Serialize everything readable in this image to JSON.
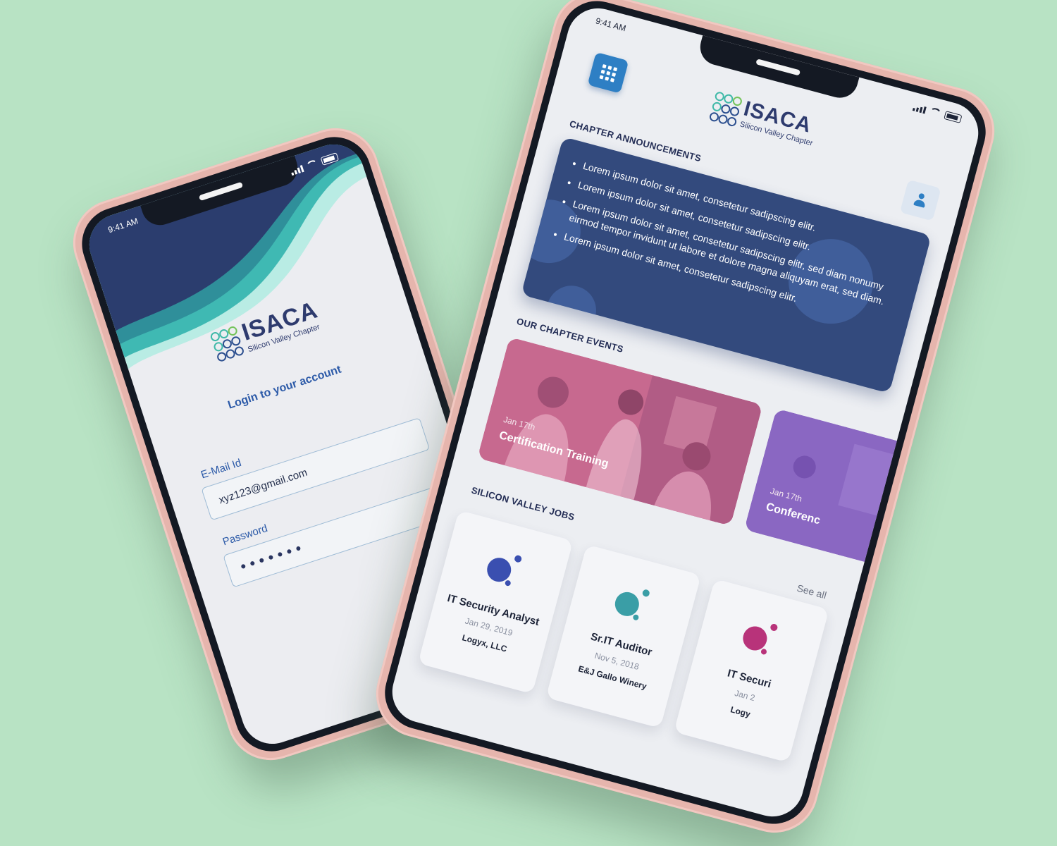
{
  "colors": {
    "background": "#b8e3c4",
    "phone_case": "#e6b5ad",
    "navy": "#2e3b6e",
    "accent_blue": "#2e7fc4",
    "teal": "#3fb9a8"
  },
  "login_screen": {
    "status": {
      "time": "9:41 AM"
    },
    "logo": {
      "word": "ISACA",
      "subtitle": "Silicon Valley Chapter"
    },
    "title": "Login to your account",
    "email": {
      "label": "E-Mail Id",
      "value": "xyz123@gmail.com"
    },
    "password": {
      "label": "Password",
      "value": "•••••••"
    }
  },
  "home_screen": {
    "status": {
      "time": "9:41 AM"
    },
    "menu_icon": "grid-menu-icon",
    "profile_icon": "user-icon",
    "logo": {
      "word": "ISACA",
      "subtitle": "Silicon Valley Chapter"
    },
    "announcements": {
      "title": "CHAPTER ANNOUNCEMENTS",
      "items": [
        "Lorem ipsum dolor sit amet, consetetur sadipscing elitr.",
        "Lorem ipsum dolor sit amet, consetetur sadipscing elitr.",
        "Lorem ipsum dolor sit amet, consetetur sadipscing elitr, sed diam nonumy eirmod tempor invidunt ut labore et dolore magna aliquyam erat, sed diam.",
        "Lorem ipsum dolor sit amet, consetetur sadipscing elitr."
      ]
    },
    "events": {
      "title": "OUR CHAPTER EVENTS",
      "items": [
        {
          "date": "Jan 17th",
          "name": "Certification Training",
          "tint": "#c7698f"
        },
        {
          "date": "Jan 17th",
          "name": "Conferenc",
          "tint": "#8a67c2"
        }
      ]
    },
    "jobs": {
      "title": "SILICON VALLEY JOBS",
      "see_all": "See all",
      "items": [
        {
          "title": "IT Security Analyst",
          "date": "Jan 29, 2019",
          "company": "Logyx, LLC",
          "color": "#3a4fb0"
        },
        {
          "title": "Sr.IT Auditor",
          "date": "Nov 5, 2018",
          "company": "E&J Gallo Winery",
          "color": "#3a9ea6"
        },
        {
          "title": "IT Securi",
          "date": "Jan 2",
          "company": "Logy",
          "color": "#b8337a"
        }
      ]
    }
  }
}
